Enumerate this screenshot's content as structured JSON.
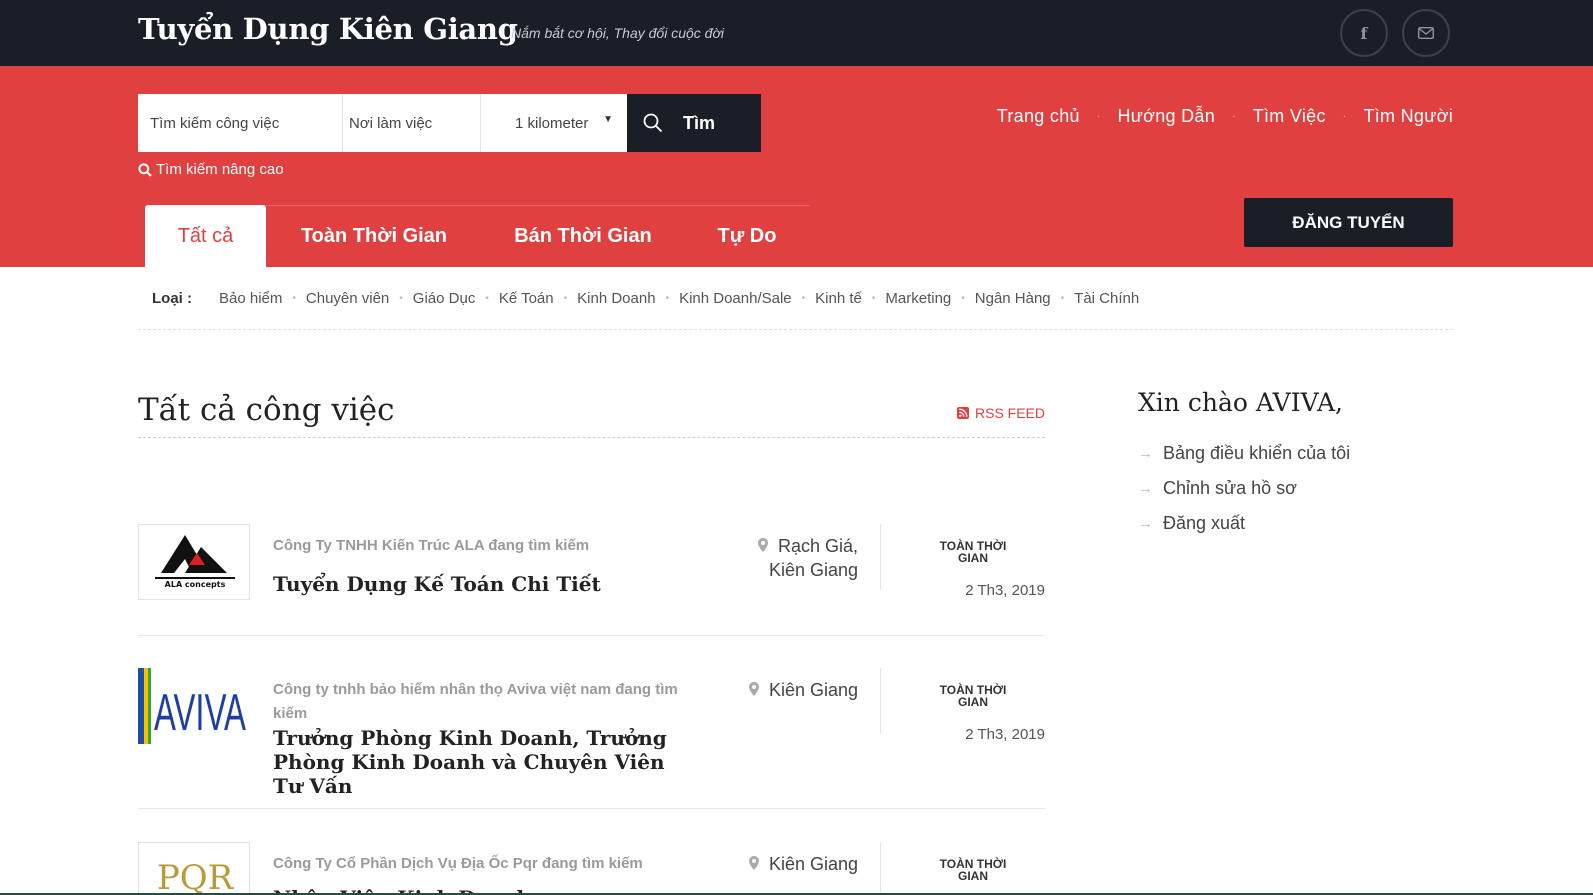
{
  "header": {
    "brand": "Tuyển Dụng Kiên Giang",
    "tagline": "Nắm bắt cơ hội, Thay đổi cuộc đời",
    "social": [
      {
        "icon": "facebook-icon",
        "glyph": "f"
      },
      {
        "icon": "envelope-icon"
      }
    ]
  },
  "search": {
    "keyword_placeholder": "Tìm kiếm công việc",
    "location_placeholder": "Nơi làm việc",
    "distance_value": "1 kilometer",
    "button_label": "Tìm",
    "advanced_label": "Tìm kiếm nâng cao"
  },
  "nav": {
    "items": [
      "Trang chủ",
      "Hướng Dẫn",
      "Tìm Việc",
      "Tìm Người"
    ],
    "separator": "·"
  },
  "tabs": [
    {
      "label": "Tất cả",
      "active": true
    },
    {
      "label": "Toàn Thời Gian",
      "active": false
    },
    {
      "label": "Bán Thời Gian",
      "active": false
    },
    {
      "label": "Tự Do",
      "active": false
    }
  ],
  "post_button": "ĐĂNG TUYỂN",
  "categories": {
    "label": "Loại :",
    "items": [
      "Bảo hiểm",
      "Chuyên viên",
      "Giáo Dục",
      "Kế Toán",
      "Kinh Doanh",
      "Kinh Doanh/Sale",
      "Kinh tế",
      "Marketing",
      "Ngân Hàng",
      "Tài Chính"
    ]
  },
  "main": {
    "title": "Tất cả công việc",
    "rss_label": "RSS FEED"
  },
  "jobs": [
    {
      "logo": "ALA concepts",
      "company": "Công Ty TNHH Kiến Trúc ALA đang tìm kiếm",
      "title": "Tuyển Dụng Kế Toán Chi Tiết",
      "location_line1": "Rạch Giá,",
      "location_line2": "Kiên Giang",
      "type": "TOÀN THỜI GIAN",
      "date": "2 Th3, 2019"
    },
    {
      "logo": "AVIVA",
      "company": "Công ty tnhh bảo hiểm nhân thọ Aviva việt nam đang tìm kiếm",
      "title": "Trưởng Phòng Kinh Doanh, Trưởng Phòng Kinh Doanh và Chuyên Viên Tư Vấn",
      "location_line1": "Kiên Giang",
      "location_line2": "",
      "type": "TOÀN THỜI GIAN",
      "date": "2 Th3, 2019"
    },
    {
      "logo": "PQR",
      "company": "Công Ty Cổ Phần Dịch Vụ Địa Ốc Pqr đang tìm kiếm",
      "title": "Nhân Viên Kinh Doanh",
      "location_line1": "Kiên Giang",
      "location_line2": "",
      "type": "TOÀN THỜI GIAN",
      "date": ""
    }
  ],
  "sidebar": {
    "greeting": "Xin chào AVIVA,",
    "links": [
      "Bảng điều khiển của tôi",
      "Chỉnh sửa hồ sơ",
      "Đăng xuất"
    ]
  },
  "colors": {
    "accent": "#e04040",
    "dark": "#1a1f27"
  }
}
